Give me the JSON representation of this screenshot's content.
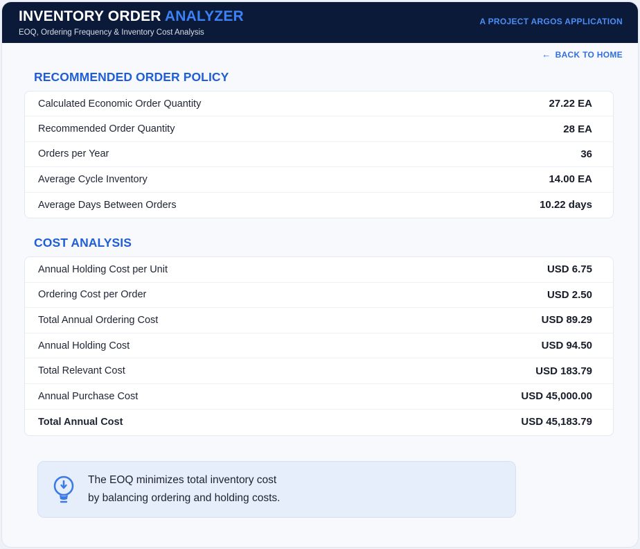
{
  "header": {
    "title_main": "INVENTORY ORDER ",
    "title_accent": "ANALYZER",
    "subtitle": "EOQ, Ordering Frequency & Inventory Cost Analysis",
    "brand": "A PROJECT ARGOS APPLICATION"
  },
  "nav": {
    "back_arrow": "←",
    "back_label": "BACK TO HOME"
  },
  "policy": {
    "title": "RECOMMENDED ORDER POLICY",
    "rows": [
      {
        "label": "Calculated Economic Order Quantity",
        "value": "27.22 EA"
      },
      {
        "label": "Recommended Order Quantity",
        "value": "28 EA"
      },
      {
        "label": "Orders per Year",
        "value": "36"
      },
      {
        "label": "Average Cycle Inventory",
        "value": "14.00 EA"
      },
      {
        "label": "Average Days Between Orders",
        "value": "10.22 days"
      }
    ]
  },
  "cost": {
    "title": "COST ANALYSIS",
    "rows": [
      {
        "label": "Annual Holding Cost per Unit",
        "value": "USD 6.75"
      },
      {
        "label": "Ordering Cost per Order",
        "value": "USD 2.50"
      },
      {
        "label": "Total Annual Ordering Cost",
        "value": "USD 89.29"
      },
      {
        "label": "Annual Holding Cost",
        "value": "USD 94.50"
      },
      {
        "label": "Total Relevant Cost",
        "value": "USD 183.79"
      },
      {
        "label": "Annual Purchase Cost",
        "value": "USD 45,000.00"
      },
      {
        "label": "Total Annual Cost",
        "value": "USD 45,183.79"
      }
    ]
  },
  "note": {
    "icon": "lightbulb-icon",
    "line1": "The EOQ minimizes total inventory cost",
    "line2": "by balancing ordering and holding costs."
  },
  "colors": {
    "header_bg": "#0c1a3a",
    "accent": "#3b82f6",
    "section_title": "#1f5ed6",
    "note_bg": "#e6eefb"
  }
}
